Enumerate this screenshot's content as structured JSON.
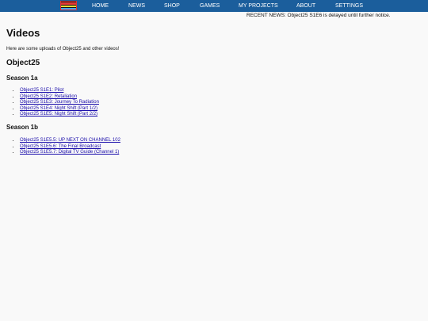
{
  "nav": {
    "items": [
      "HOME",
      "NEWS",
      "SHOP",
      "GAMES",
      "MY PROJECTS",
      "ABOUT",
      "SETTINGS"
    ]
  },
  "ticker": "RECENT NEWS: Object25 S1E6 is delayed until further notice.",
  "page": {
    "title": "Videos",
    "intro": "Here are some uploads of Object25 and other videos!",
    "section_title": "Object25",
    "seasons": [
      {
        "title": "Season 1a",
        "episodes": [
          "Object25 S1E1: Pilot",
          "Object25 S1E2: Retaliation",
          "Object25 S1E3: Journey To Radiation",
          "Object25 S1E4: Night Shift (Part 1/2)",
          "Object25 S1E5: Night Shift (Part 2/2)"
        ]
      },
      {
        "title": "Season 1b",
        "episodes": [
          "Object25 S1E5.5: UP NEXT ON CHANNEL 102",
          "Object25 S1E5.6: The Final Broadcast",
          "Object25 S1E5.7: Digital TV Guide (Channel 1)"
        ]
      }
    ]
  },
  "colors": {
    "navbar": "#1b5e9c",
    "background": "#f9f9f9",
    "link": "#1a0dab"
  }
}
